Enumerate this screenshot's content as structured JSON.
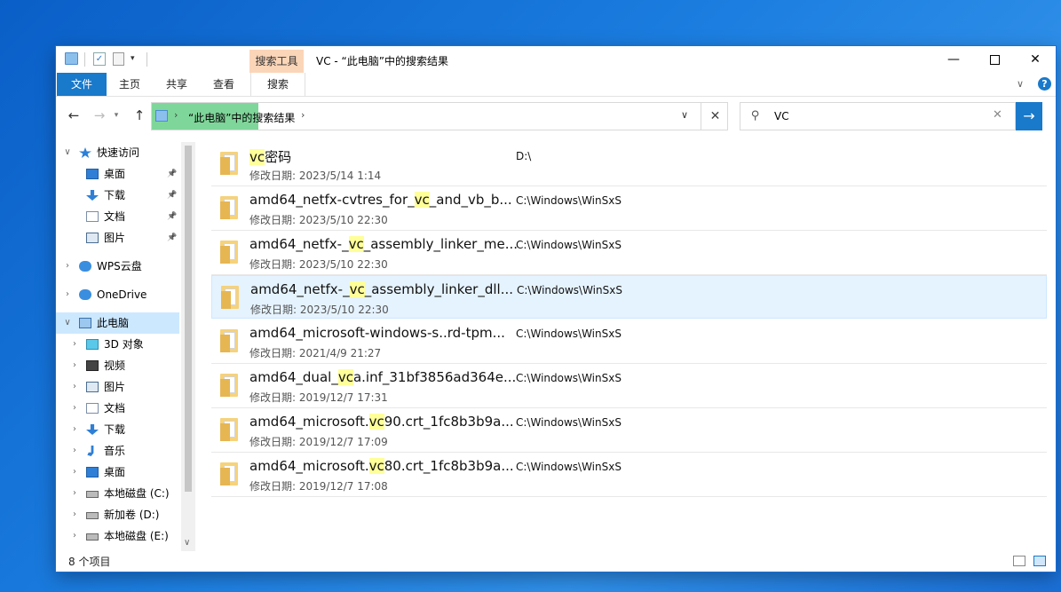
{
  "window": {
    "title": "VC - “此电脑”中的搜索结果",
    "contextual_tab": "搜索工具"
  },
  "ribbon": {
    "tabs": [
      "文件",
      "主页",
      "共享",
      "查看",
      "搜索"
    ]
  },
  "address": {
    "path_label": "“此电脑”中的搜索结果"
  },
  "search": {
    "value": "VC"
  },
  "sidebar": {
    "items": [
      {
        "label": "快速访问",
        "icon": "star-icon"
      },
      {
        "label": "桌面",
        "icon": "desktop-icon"
      },
      {
        "label": "下载",
        "icon": "download-icon"
      },
      {
        "label": "文档",
        "icon": "document-icon"
      },
      {
        "label": "图片",
        "icon": "picture-icon"
      },
      {
        "label": "WPS云盘",
        "icon": "cloud-icon"
      },
      {
        "label": "OneDrive",
        "icon": "cloud-icon"
      },
      {
        "label": "此电脑",
        "icon": "computer-icon"
      },
      {
        "label": "3D 对象",
        "icon": "cube-icon"
      },
      {
        "label": "视频",
        "icon": "video-icon"
      },
      {
        "label": "图片",
        "icon": "picture-icon"
      },
      {
        "label": "文档",
        "icon": "document-icon"
      },
      {
        "label": "下载",
        "icon": "download-icon"
      },
      {
        "label": "音乐",
        "icon": "music-icon"
      },
      {
        "label": "桌面",
        "icon": "desktop-icon"
      },
      {
        "label": "本地磁盘 (C:)",
        "icon": "drive-icon"
      },
      {
        "label": "新加卷 (D:)",
        "icon": "drive-icon"
      },
      {
        "label": "本地磁盘 (E:)",
        "icon": "drive-icon"
      }
    ]
  },
  "results": {
    "date_label": "修改日期:",
    "items": [
      {
        "pre": "",
        "hl": "vc",
        "post": "密码",
        "date": "2023/5/14 1:14",
        "path": "D:\\"
      },
      {
        "pre": "amd64_netfx-cvtres_for_",
        "hl": "vc",
        "post": "_and_vb_b...",
        "date": "2023/5/10 22:30",
        "path": "C:\\Windows\\WinSxS"
      },
      {
        "pre": "amd64_netfx-_",
        "hl": "vc",
        "post": "_assembly_linker_me...",
        "date": "2023/5/10 22:30",
        "path": "C:\\Windows\\WinSxS"
      },
      {
        "pre": "amd64_netfx-_",
        "hl": "vc",
        "post": "_assembly_linker_dll...",
        "date": "2023/5/10 22:30",
        "path": "C:\\Windows\\WinSxS"
      },
      {
        "pre": "amd64_microsoft-windows-s..rd-tpm...",
        "hl": "",
        "post": "",
        "date": "2021/4/9 21:27",
        "path": "C:\\Windows\\WinSxS"
      },
      {
        "pre": "amd64_dual_",
        "hl": "vc",
        "post": "a.inf_31bf3856ad364e...",
        "date": "2019/12/7 17:31",
        "path": "C:\\Windows\\WinSxS"
      },
      {
        "pre": "amd64_microsoft.",
        "hl": "vc",
        "post": "90.crt_1fc8b3b9a...",
        "date": "2019/12/7 17:09",
        "path": "C:\\Windows\\WinSxS"
      },
      {
        "pre": "amd64_microsoft.",
        "hl": "vc",
        "post": "80.crt_1fc8b3b9a...",
        "date": "2019/12/7 17:08",
        "path": "C:\\Windows\\WinSxS"
      }
    ]
  },
  "status": {
    "count": "8 个项目"
  },
  "colors": {
    "accent": "#1979ca",
    "highlight": "#ffff99",
    "selection": "#cce8ff"
  }
}
